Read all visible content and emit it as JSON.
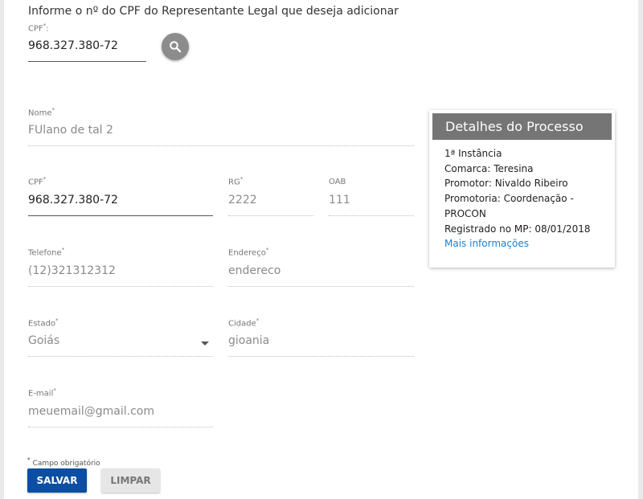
{
  "intro": "Informe o nº do CPF do Representante Legal que deseja adicionar",
  "required_mark": "*",
  "search": {
    "label": "CPF",
    "value": "968.327.380-72",
    "icon": "search-icon"
  },
  "fields": {
    "nome": {
      "label": "Nome",
      "value": "FUlano de tal 2"
    },
    "cpf": {
      "label": "CPF",
      "value": "968.327.380-72"
    },
    "rg": {
      "label": "RG",
      "value": "2222"
    },
    "oab": {
      "label": "OAB",
      "value": "111"
    },
    "telefone": {
      "label": "Telefone",
      "value": "(12)321312312"
    },
    "endereco": {
      "label": "Endereço",
      "value": "endereco"
    },
    "estado": {
      "label": "Estado",
      "value": "Goiás"
    },
    "cidade": {
      "label": "Cidade",
      "value": "gioania"
    },
    "email": {
      "label": "E-mail",
      "value": "meuemail@gmail.com"
    }
  },
  "card": {
    "title": "Detalhes do Processo",
    "lines": [
      "1ª Instância",
      "Comarca: Teresina",
      "Promotor: Nivaldo Ribeiro",
      "Promotoria: Coordenação -",
      "PROCON",
      "Registrado no MP: 08/01/2018"
    ],
    "link": "Mais informações"
  },
  "footer": {
    "required_note": "Campo obrigatório"
  },
  "buttons": {
    "save": "SALVAR",
    "clear": "LIMPAR"
  },
  "colors": {
    "primary": "#0b4ea2",
    "card_header": "#757575",
    "link": "#1a82d6"
  }
}
